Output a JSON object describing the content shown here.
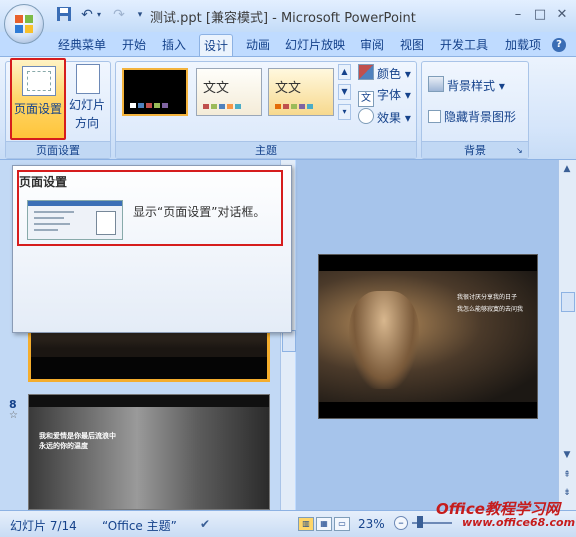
{
  "window": {
    "title": "测试.ppt [兼容模式] - Microsoft PowerPoint"
  },
  "tabs": [
    "经典菜单",
    "开始",
    "插入",
    "设计",
    "动画",
    "幻灯片放映",
    "审阅",
    "视图",
    "开发工具",
    "加载项"
  ],
  "active_tab": "设计",
  "ribbon": {
    "page_setup_group": {
      "page_setup_label": "页面设置",
      "orientation_label_1": "幻灯片",
      "orientation_label_2": "方向",
      "group_label": "页面设置"
    },
    "themes_group": {
      "theme_text_2": "文文",
      "theme_text_3": "文文",
      "colors_label": "颜色",
      "fonts_label": "字体",
      "effects_label": "效果",
      "group_label": "主题"
    },
    "background_group": {
      "styles_label": "背景样式",
      "hide_graphics_label": "隐藏背景图形",
      "group_label": "背景"
    }
  },
  "tooltip": {
    "title": "页面设置",
    "description": "显示“页面设置”对话框。"
  },
  "slide_pane": {
    "slide_8_number": "8",
    "slide_8_caption_1": "我和爱情是你最后流浪中",
    "slide_8_caption_2": "永远的你的温度"
  },
  "main_slide": {
    "caption_1": "我很讨厌分享我的日子",
    "caption_2": "我怎么能够寂寞的去问我"
  },
  "statusbar": {
    "slide_info": "幻灯片 7/14",
    "theme": "“Office 主题”",
    "zoom": "23%"
  },
  "watermark": {
    "line1": "Office教程学习网",
    "line2": "www.office68.com"
  }
}
